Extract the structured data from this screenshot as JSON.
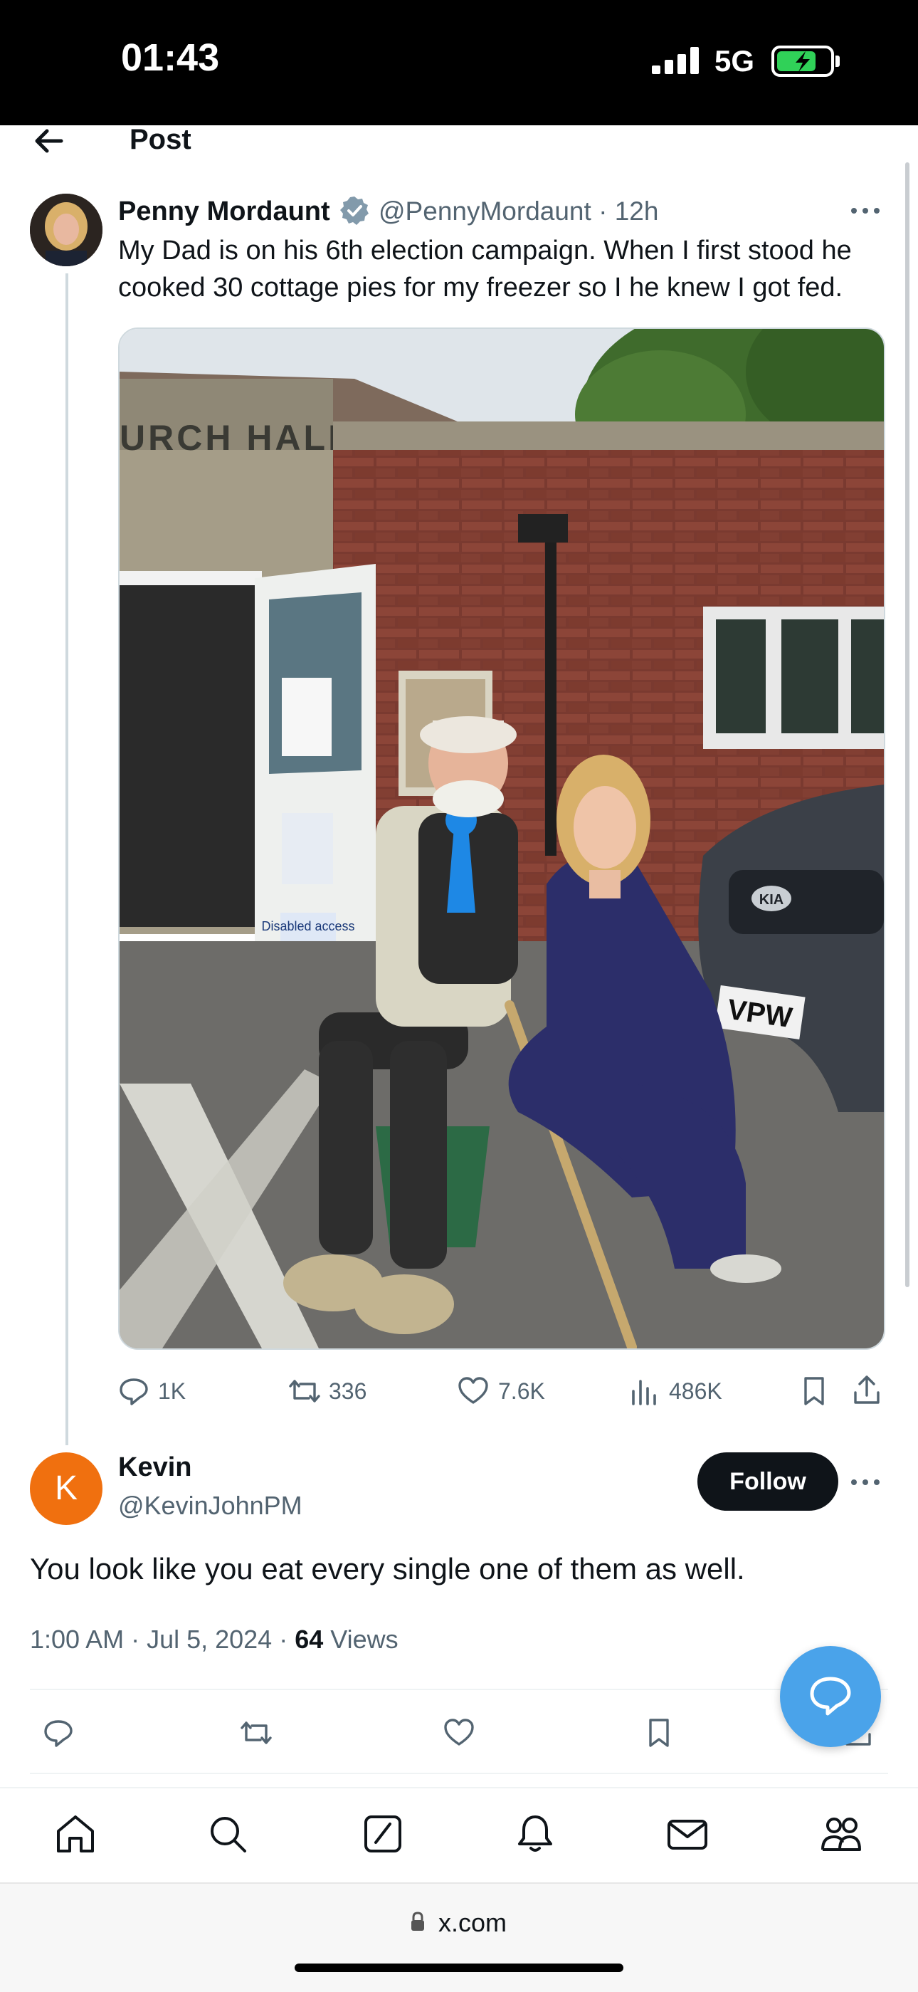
{
  "status_bar": {
    "time": "01:43",
    "network": "5G",
    "battery_level": 0.75,
    "battery_color": "#30d158"
  },
  "header": {
    "title": "Post",
    "back_icon": "arrow-left-icon"
  },
  "tweet": {
    "author_name": "Penny Mordaunt",
    "handle": "@PennyMordaunt",
    "time_ago": "12h",
    "separator": "·",
    "text": "My Dad is on his 6th election campaign. When I first stood he cooked 30 cottage pies for my freezer so I he knew I got fed.",
    "photo": {
      "sign_text": "URCH HALL",
      "notice_text": "Disabled access",
      "plate_text": "VPW",
      "car_badge": "KIA"
    },
    "stats": {
      "replies": "1K",
      "reposts": "336",
      "likes": "7.6K",
      "views": "486K"
    }
  },
  "reply": {
    "avatar_letter": "K",
    "avatar_color": "#f0700f",
    "author_name": "Kevin",
    "handle": "@KevinJohnPM",
    "follow_label": "Follow",
    "text": "You look like you eat every single one of them as well.",
    "timestamp": "1:00 AM · Jul 5, 2024 · ",
    "views_count": "64",
    "views_label": " Views"
  },
  "tab_bar": {
    "items": [
      "home-icon",
      "search-icon",
      "compose-icon",
      "bell-icon",
      "mail-icon",
      "communities-icon"
    ]
  },
  "browser": {
    "url": "x.com"
  },
  "colors": {
    "accent": "#1d9bf0",
    "fab": "#4aa3ea",
    "muted": "#536471",
    "text": "#0f1419"
  }
}
